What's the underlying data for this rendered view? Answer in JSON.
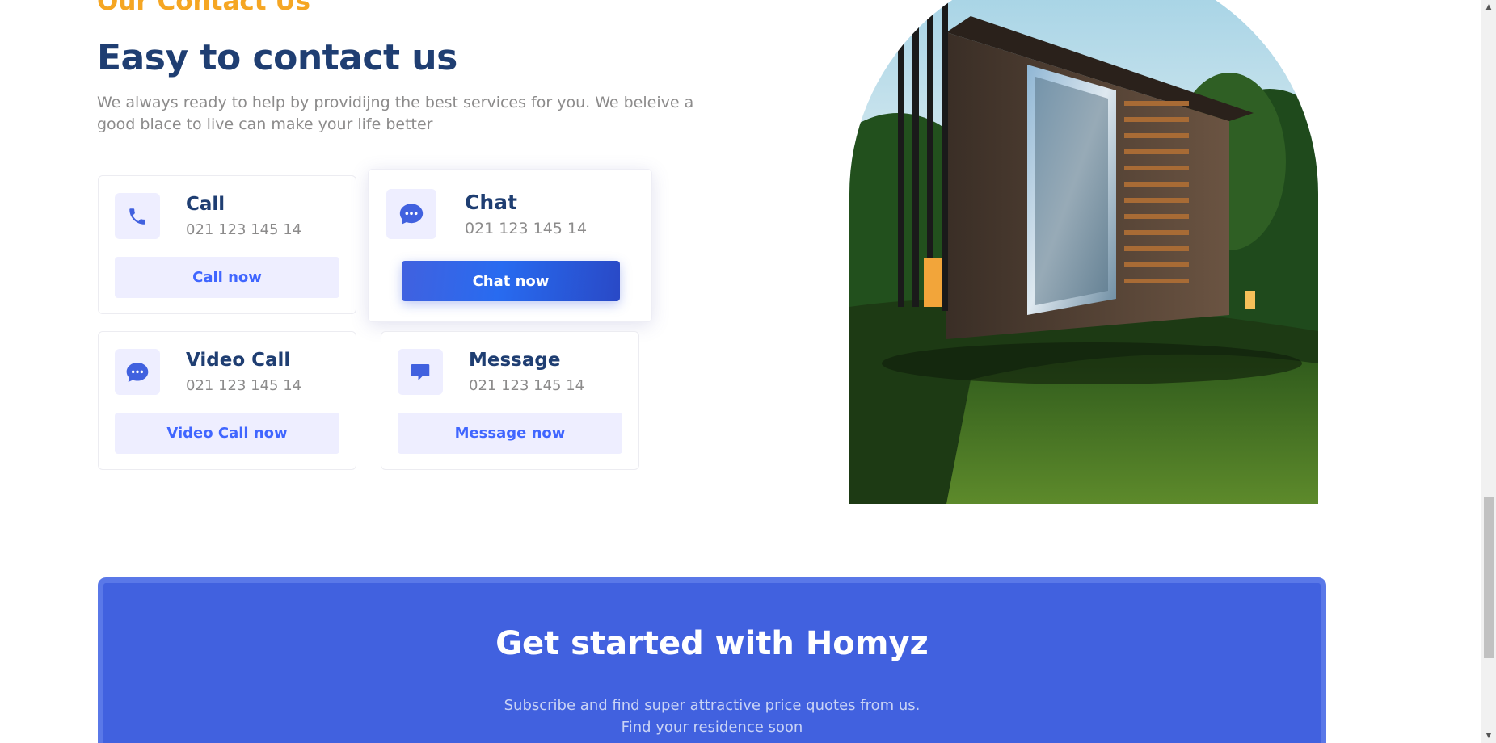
{
  "section": {
    "eyebrow": "Our Contact Us",
    "title": "Easy to contact us",
    "description": "We always ready to help by providijng the best services for you. We beleive a good blace to live can make your life better"
  },
  "contact_cards": [
    {
      "title": "Call",
      "number": "021 123 145 14",
      "button": "Call now",
      "icon": "phone-icon"
    },
    {
      "title": "Chat",
      "number": "021 123 145 14",
      "button": "Chat now",
      "icon": "chat-bubble-dots-icon"
    },
    {
      "title": "Video Call",
      "number": "021 123 145 14",
      "button": "Video Call now",
      "icon": "video-call-chat-icon"
    },
    {
      "title": "Message",
      "number": "021 123 145 14",
      "button": "Message now",
      "icon": "message-bubble-icon"
    }
  ],
  "banner": {
    "title": "Get started with Homyz",
    "subtitle_line1": "Subscribe and find super attractive price quotes from us.",
    "subtitle_line2": "Find your residence soon"
  },
  "colors": {
    "accent_orange": "#f5a623",
    "heading_navy": "#1f3e72",
    "primary_blue": "#4161df",
    "text_gray": "#8c8b8b",
    "icon_bg": "#eeeeff"
  },
  "image": {
    "subject": "modern-house-photo"
  }
}
